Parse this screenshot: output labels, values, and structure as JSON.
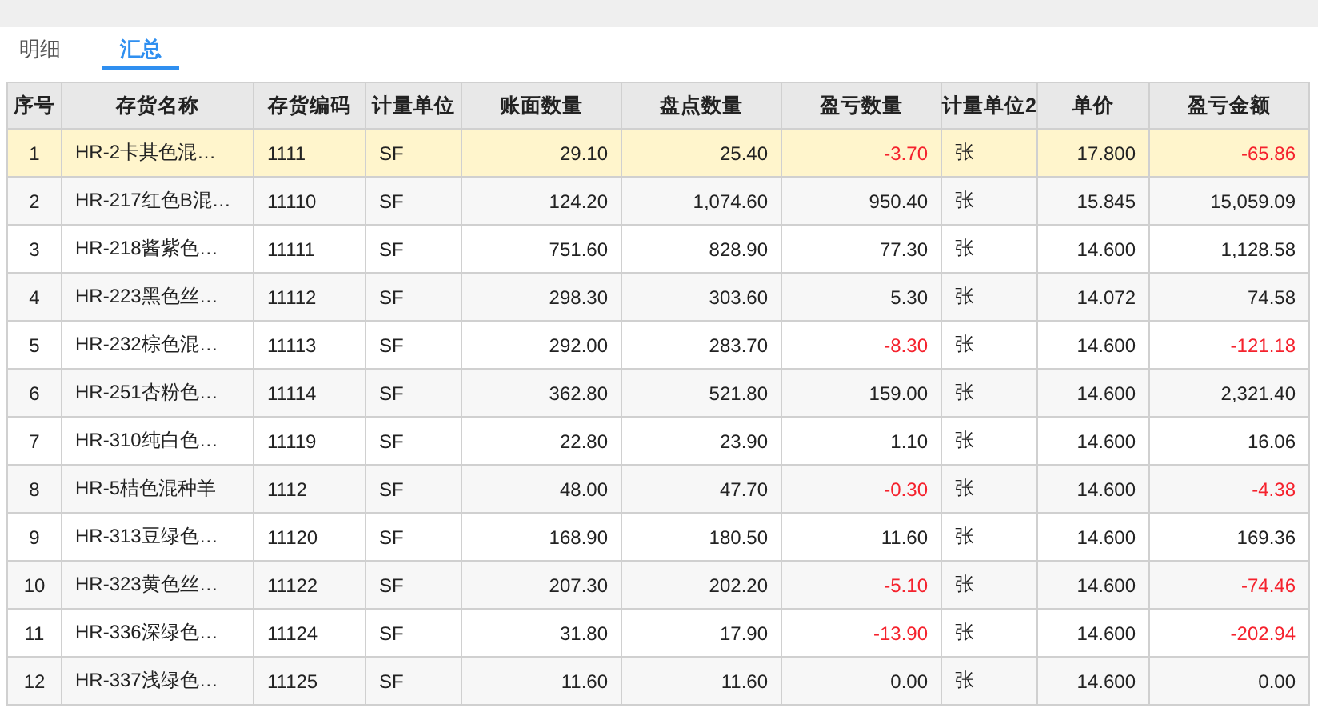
{
  "tabs": [
    {
      "label": "明细",
      "selected": false
    },
    {
      "label": "汇总",
      "selected": true
    }
  ],
  "table": {
    "columns": [
      "序号",
      "存货名称",
      "存货编码",
      "计量单位",
      "账面数量",
      "盘点数量",
      "盈亏数量",
      "计量单位2",
      "单价",
      "盈亏金额"
    ],
    "rows": [
      {
        "selected": true,
        "negative": true,
        "cells": [
          "1",
          "HR-2卡其色混…",
          "1111",
          "SF",
          "29.10",
          "25.40",
          "-3.70",
          "张",
          "17.800",
          "-65.86"
        ]
      },
      {
        "selected": false,
        "negative": false,
        "cells": [
          "2",
          "HR-217红色B混…",
          "11110",
          "SF",
          "124.20",
          "1,074.60",
          "950.40",
          "张",
          "15.845",
          "15,059.09"
        ]
      },
      {
        "selected": false,
        "negative": false,
        "cells": [
          "3",
          "HR-218酱紫色…",
          "11111",
          "SF",
          "751.60",
          "828.90",
          "77.30",
          "张",
          "14.600",
          "1,128.58"
        ]
      },
      {
        "selected": false,
        "negative": false,
        "cells": [
          "4",
          "HR-223黑色丝…",
          "11112",
          "SF",
          "298.30",
          "303.60",
          "5.30",
          "张",
          "14.072",
          "74.58"
        ]
      },
      {
        "selected": false,
        "negative": true,
        "cells": [
          "5",
          "HR-232棕色混…",
          "11113",
          "SF",
          "292.00",
          "283.70",
          "-8.30",
          "张",
          "14.600",
          "-121.18"
        ]
      },
      {
        "selected": false,
        "negative": false,
        "cells": [
          "6",
          "HR-251杏粉色…",
          "11114",
          "SF",
          "362.80",
          "521.80",
          "159.00",
          "张",
          "14.600",
          "2,321.40"
        ]
      },
      {
        "selected": false,
        "negative": false,
        "cells": [
          "7",
          "HR-310纯白色…",
          "11119",
          "SF",
          "22.80",
          "23.90",
          "1.10",
          "张",
          "14.600",
          "16.06"
        ]
      },
      {
        "selected": false,
        "negative": true,
        "cells": [
          "8",
          "HR-5桔色混种羊",
          "1112",
          "SF",
          "48.00",
          "47.70",
          "-0.30",
          "张",
          "14.600",
          "-4.38"
        ]
      },
      {
        "selected": false,
        "negative": false,
        "cells": [
          "9",
          "HR-313豆绿色…",
          "11120",
          "SF",
          "168.90",
          "180.50",
          "11.60",
          "张",
          "14.600",
          "169.36"
        ]
      },
      {
        "selected": false,
        "negative": true,
        "cells": [
          "10",
          "HR-323黄色丝…",
          "11122",
          "SF",
          "207.30",
          "202.20",
          "-5.10",
          "张",
          "14.600",
          "-74.46"
        ]
      },
      {
        "selected": false,
        "negative": true,
        "cells": [
          "11",
          "HR-336深绿色…",
          "11124",
          "SF",
          "31.80",
          "17.90",
          "-13.90",
          "张",
          "14.600",
          "-202.94"
        ]
      },
      {
        "selected": false,
        "negative": false,
        "cells": [
          "12",
          "HR-337浅绿色…",
          "11125",
          "SF",
          "11.60",
          "11.60",
          "0.00",
          "张",
          "14.600",
          "0.00"
        ]
      }
    ]
  }
}
